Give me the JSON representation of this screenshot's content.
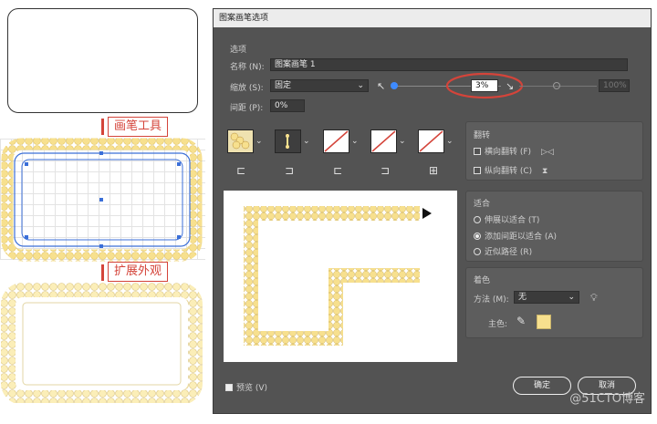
{
  "captions": {
    "top": "画笔工具",
    "bottom": "扩展外观"
  },
  "dialog": {
    "title": "图案画笔选项",
    "options_heading": "选项",
    "name_label": "名称 (N):",
    "name_value": "图案画笔 1",
    "scale_label": "缩放 (S):",
    "scale_mode": "固定",
    "scale_value": "3%",
    "scale_max": "100%",
    "spacing_label": "间距 (P):",
    "spacing_value": "0%",
    "flip_heading": "翻转",
    "flip_h_label": "横向翻转 (F)",
    "flip_v_label": "纵向翻转 (C)",
    "fit_heading": "适合",
    "fit_options": [
      "伸展以适合 (T)",
      "添加间距以适合 (A)",
      "近似路径 (R)"
    ],
    "fit_selected": 1,
    "color_heading": "着色",
    "method_label": "方法 (M):",
    "method_value": "无",
    "key_color_label": "主色:",
    "key_color": "#f7e08e",
    "preview_label": "预览 (V)",
    "preview_checked": true,
    "ok_label": "确定",
    "cancel_label": "取消",
    "tile_icons": [
      "side-tile-icon",
      "outer-corner-tile-icon",
      "no-tile-icon",
      "no-tile-icon",
      "no-tile-icon"
    ]
  },
  "accent": {
    "highlight": "#d4443a",
    "pattern_fill": "#f7e08e",
    "path_blue": "#3b6fd8"
  },
  "watermark": "@51CTO博客"
}
